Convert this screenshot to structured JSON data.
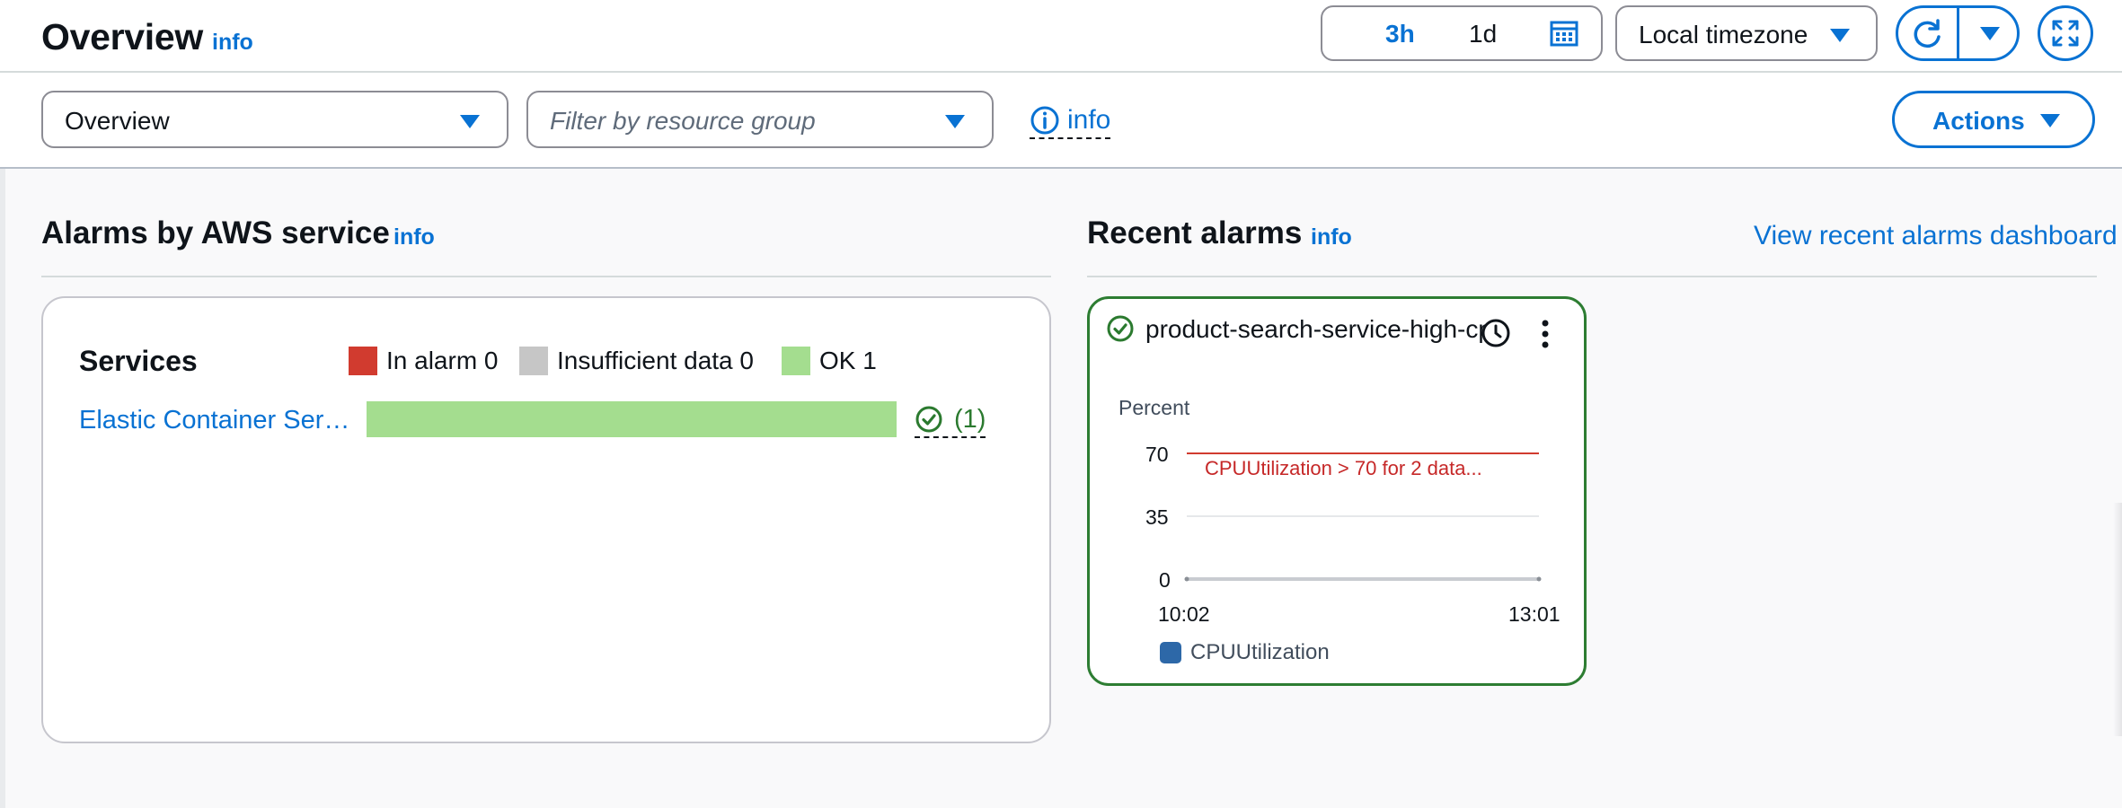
{
  "header": {
    "title": "Overview",
    "info_label": "info",
    "time_range": {
      "option_3h": "3h",
      "option_1d": "1d",
      "calendar_icon": "calendar-icon"
    },
    "timezone": {
      "selected": "Local timezone"
    },
    "refresh_icon": "refresh-icon",
    "fullscreen_icon": "fullscreen-icon"
  },
  "toolbar": {
    "dashboard_select": {
      "selected": "Overview"
    },
    "resource_filter": {
      "placeholder": "Filter by resource group"
    },
    "info_label": "info",
    "actions_label": "Actions"
  },
  "alarms_by_service": {
    "title": "Alarms by AWS service",
    "info_label": "info",
    "card": {
      "heading": "Services",
      "legend": [
        {
          "label": "In alarm 0",
          "color": "#d13b2f"
        },
        {
          "label": "Insufficient data 0",
          "color": "#c6c6c6"
        },
        {
          "label": "OK 1",
          "color": "#a4dd8f"
        }
      ],
      "rows": [
        {
          "service": "Elastic Container Ser…",
          "ok_fraction": 1.0,
          "count": "(1)"
        }
      ]
    }
  },
  "recent_alarms": {
    "title": "Recent alarms",
    "info_label": "info",
    "view_dashboard_link": "View recent alarms dashboard",
    "cards": [
      {
        "name": "product-search-service-high-cpu",
        "status_color": "#2d7d32",
        "chart_data": {
          "type": "line",
          "ylabel": "Percent",
          "y_ticks": [
            "70",
            "35",
            "0"
          ],
          "ylim": [
            0,
            70
          ],
          "x_ticks": [
            "10:02",
            "13:01"
          ],
          "threshold": {
            "value": 70,
            "label": "CPUUtilization > 70 for 2 data...",
            "color": "#d13b2f"
          },
          "series": [
            {
              "name": "CPUUtilization",
              "color": "#2d68a8",
              "values": [
                0,
                0
              ]
            }
          ],
          "grid": true
        }
      }
    ]
  }
}
